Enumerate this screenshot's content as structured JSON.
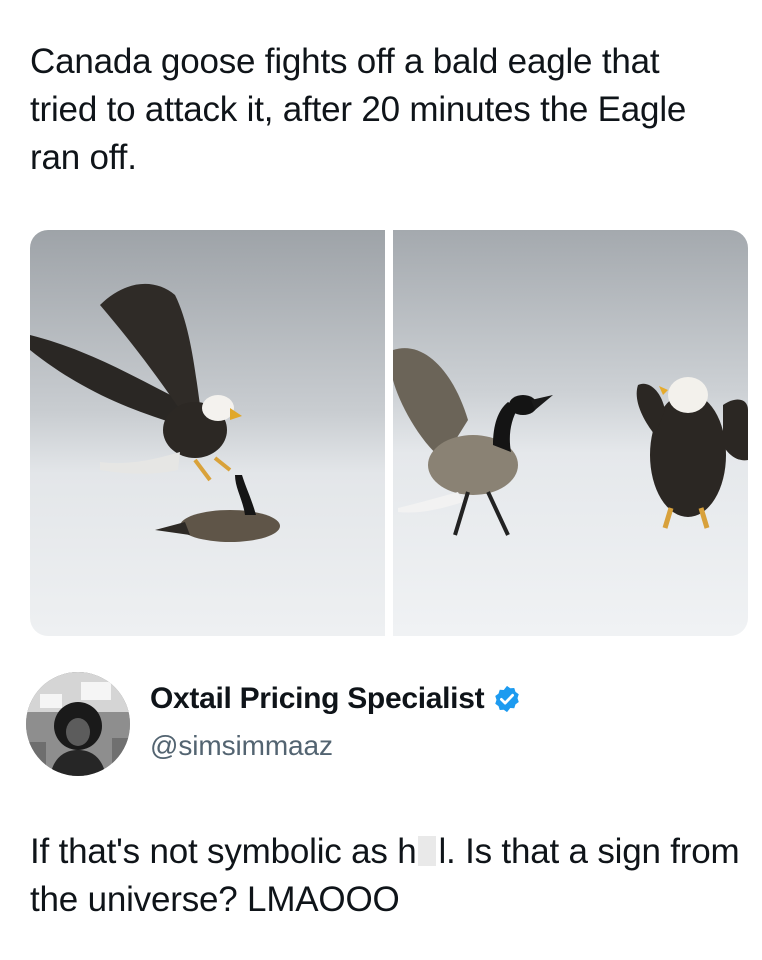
{
  "post": {
    "text": "Canada goose fights off a bald eagle that tried to attack it, after 20 minutes the Eagle ran off."
  },
  "media": {
    "panels": [
      {
        "depicts": "eagle-swooping-on-goose"
      },
      {
        "depicts": "goose-confronting-eagle"
      }
    ]
  },
  "reply": {
    "author": {
      "display_name": "Oxtail Pricing Specialist",
      "handle": "@simsimmaaz",
      "verified_icon": "verified-badge-icon",
      "verified_color": "#1d9bf0"
    },
    "text_before": "If that's not symbolic as h",
    "text_after": "l. Is that a sign from the universe? LMAOOO"
  },
  "colors": {
    "text": "#0f1419",
    "secondary_text": "#536471"
  }
}
